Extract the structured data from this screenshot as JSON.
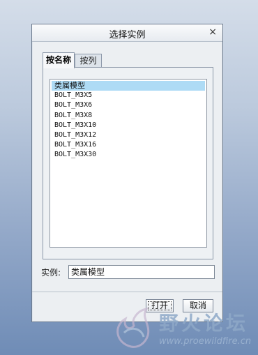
{
  "dialog": {
    "title": "选择实例",
    "close_glyph": "×"
  },
  "tabs": [
    {
      "label": "按名称",
      "active": true
    },
    {
      "label": "按列",
      "active": false
    }
  ],
  "list": {
    "items": [
      "类属模型",
      "BOLT_M3X5",
      "BOLT_M3X6",
      "BOLT_M3X8",
      "BOLT_M3X10",
      "BOLT_M3X12",
      "BOLT_M3X16",
      "BOLT_M3X30"
    ],
    "selected_index": 0
  },
  "instance": {
    "label": "实例:",
    "value": "类属模型"
  },
  "buttons": {
    "open": "打开",
    "cancel": "取消"
  },
  "watermark": {
    "cn": "野火论坛",
    "url": "www.proewildfire.cn"
  },
  "colors": {
    "selection": "#aedbf5",
    "background_top": "#d4dde9",
    "background_bottom": "#6f8cb6"
  }
}
